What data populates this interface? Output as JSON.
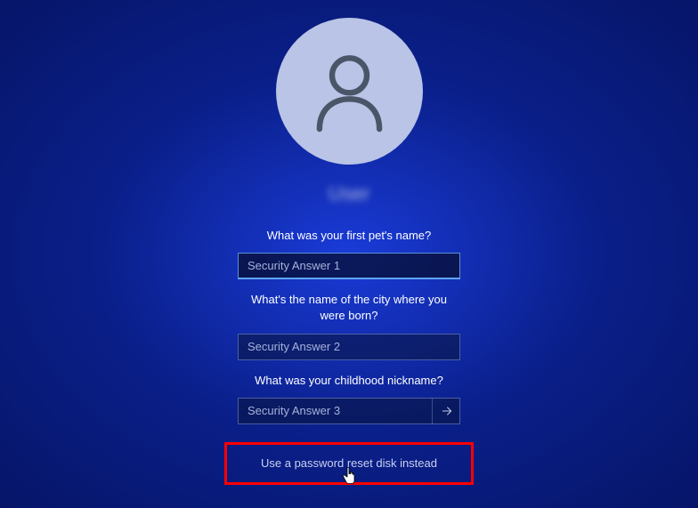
{
  "avatar": {
    "icon": "person-icon"
  },
  "username": "User",
  "questions": {
    "q1": {
      "text": "What was your first pet's name?",
      "placeholder": "Security Answer 1"
    },
    "q2": {
      "text": "What's the name of the city where you were born?",
      "placeholder": "Security Answer 2"
    },
    "q3": {
      "text": "What was your childhood nickname?",
      "placeholder": "Security Answer 3"
    }
  },
  "reset_link": {
    "label": "Use a password reset disk instead"
  },
  "colors": {
    "bg_gradient_center": "#1a3bd8",
    "bg_gradient_edge": "#061568",
    "avatar_bg": "#b9c4e6",
    "highlight_border": "#ff0000"
  }
}
